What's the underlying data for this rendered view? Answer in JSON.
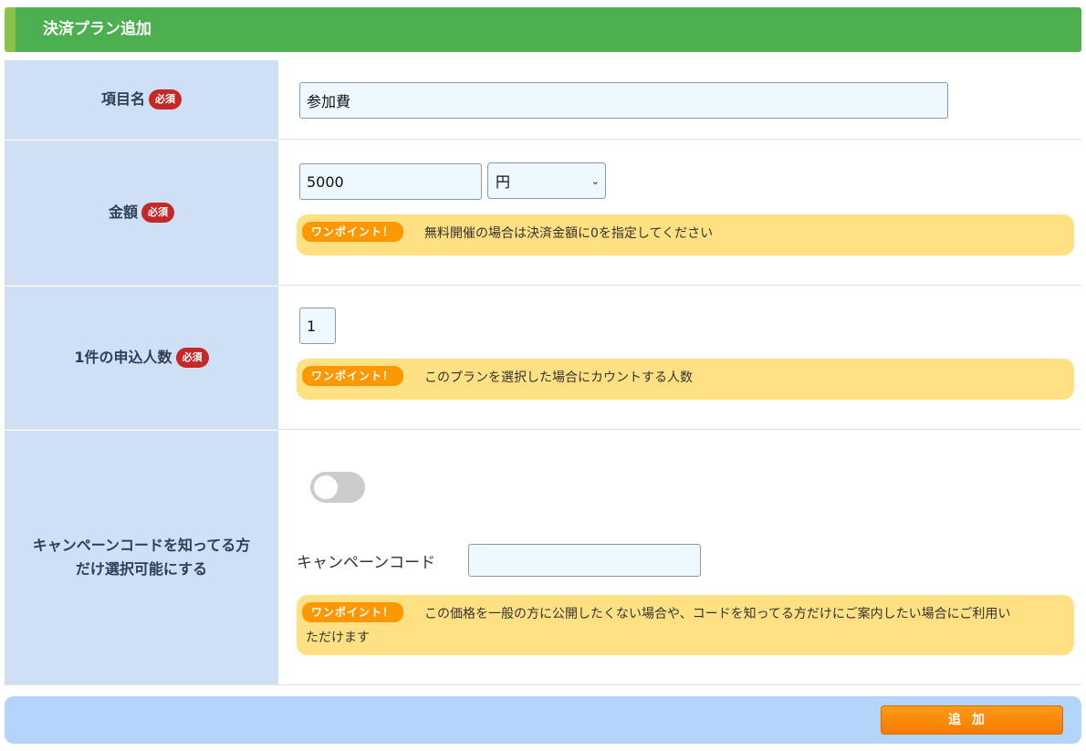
{
  "header": {
    "title": "決済プラン追加"
  },
  "required_label": "必須",
  "tip_tag": "ワンポイント！",
  "item_name": {
    "label": "項目名",
    "value": "参加費"
  },
  "amount": {
    "label": "金額",
    "value": "5000",
    "currency": "円",
    "tip": "無料開催の場合は決済金額に0を指定してください"
  },
  "applicants": {
    "label": "1件の申込人数",
    "value": "1",
    "tip": "このプランを選択した場合にカウントする人数"
  },
  "campaign": {
    "label_line1": "キャンペーンコードを知ってる方",
    "label_line2": "だけ選択可能にする",
    "toggle_on": false,
    "code_label": "キャンペーンコード",
    "code_value": "",
    "tip_line1": "この価格を一般の方に公開したくない場合や、コードを知ってる方だけにご案内したい場合にご利用い",
    "tip_line2": "ただけます"
  },
  "footer": {
    "add_label": "追加"
  },
  "colors": {
    "header": "#4caf50",
    "label_bg": "#cfe0f5",
    "required": "#c62828",
    "tip_bg": "#ffe082",
    "tip_tag": "#ff9800",
    "button": "#f57c00",
    "footer_bg": "#b3d4fb"
  }
}
